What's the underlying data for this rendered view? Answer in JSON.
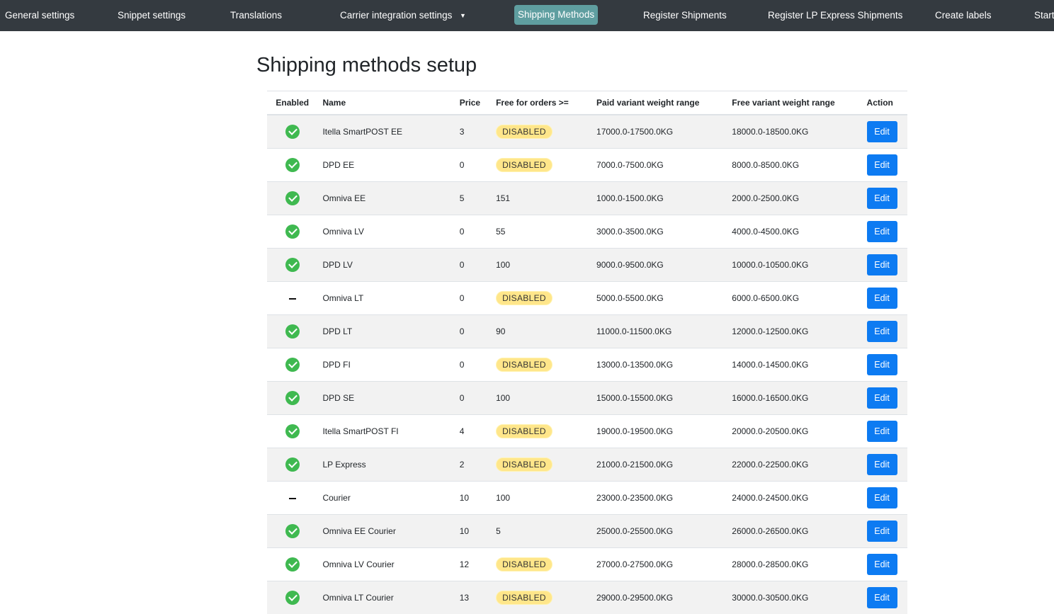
{
  "nav": {
    "items": [
      {
        "label": "General settings",
        "active": false
      },
      {
        "label": "Snippet settings",
        "active": false
      },
      {
        "label": "Translations",
        "active": false
      },
      {
        "label": "Carrier integration settings",
        "active": false,
        "dropdown": true
      },
      {
        "label": "Shipping Methods",
        "active": true
      },
      {
        "label": "Register Shipments",
        "active": false
      },
      {
        "label": "Register LP Express Shipments",
        "active": false
      },
      {
        "label": "Create labels",
        "active": false
      },
      {
        "label": "Starti",
        "active": false
      }
    ],
    "dropdown_icon": "caret-down-icon",
    "active_color": "#5f9ea0",
    "bar_color": "#343a40"
  },
  "page": {
    "title": "Shipping methods setup"
  },
  "table": {
    "headers": {
      "enabled": "Enabled",
      "name": "Name",
      "price": "Price",
      "free": "Free for orders >=",
      "paid_range": "Paid variant weight range",
      "free_range": "Free variant weight range",
      "action": "Action"
    },
    "edit_label": "Edit",
    "disabled_label": "DISABLED",
    "rows": [
      {
        "enabled": true,
        "name": "Itella SmartPOST EE",
        "price": "3",
        "free": null,
        "paid_range": "17000.0-17500.0KG",
        "free_range": "18000.0-18500.0KG"
      },
      {
        "enabled": true,
        "name": "DPD EE",
        "price": "0",
        "free": null,
        "paid_range": "7000.0-7500.0KG",
        "free_range": "8000.0-8500.0KG"
      },
      {
        "enabled": true,
        "name": "Omniva EE",
        "price": "5",
        "free": "151",
        "paid_range": "1000.0-1500.0KG",
        "free_range": "2000.0-2500.0KG"
      },
      {
        "enabled": true,
        "name": "Omniva LV",
        "price": "0",
        "free": "55",
        "paid_range": "3000.0-3500.0KG",
        "free_range": "4000.0-4500.0KG"
      },
      {
        "enabled": true,
        "name": "DPD LV",
        "price": "0",
        "free": "100",
        "paid_range": "9000.0-9500.0KG",
        "free_range": "10000.0-10500.0KG"
      },
      {
        "enabled": false,
        "name": "Omniva LT",
        "price": "0",
        "free": null,
        "paid_range": "5000.0-5500.0KG",
        "free_range": "6000.0-6500.0KG"
      },
      {
        "enabled": true,
        "name": "DPD LT",
        "price": "0",
        "free": "90",
        "paid_range": "11000.0-11500.0KG",
        "free_range": "12000.0-12500.0KG"
      },
      {
        "enabled": true,
        "name": "DPD FI",
        "price": "0",
        "free": null,
        "paid_range": "13000.0-13500.0KG",
        "free_range": "14000.0-14500.0KG"
      },
      {
        "enabled": true,
        "name": "DPD SE",
        "price": "0",
        "free": "100",
        "paid_range": "15000.0-15500.0KG",
        "free_range": "16000.0-16500.0KG"
      },
      {
        "enabled": true,
        "name": "Itella SmartPOST FI",
        "price": "4",
        "free": null,
        "paid_range": "19000.0-19500.0KG",
        "free_range": "20000.0-20500.0KG"
      },
      {
        "enabled": true,
        "name": "LP Express",
        "price": "2",
        "free": null,
        "paid_range": "21000.0-21500.0KG",
        "free_range": "22000.0-22500.0KG"
      },
      {
        "enabled": false,
        "name": "Courier",
        "price": "10",
        "free": "100",
        "paid_range": "23000.0-23500.0KG",
        "free_range": "24000.0-24500.0KG"
      },
      {
        "enabled": true,
        "name": "Omniva EE Courier",
        "price": "10",
        "free": "5",
        "paid_range": "25000.0-25500.0KG",
        "free_range": "26000.0-26500.0KG"
      },
      {
        "enabled": true,
        "name": "Omniva LV Courier",
        "price": "12",
        "free": null,
        "paid_range": "27000.0-27500.0KG",
        "free_range": "28000.0-28500.0KG"
      },
      {
        "enabled": true,
        "name": "Omniva LT Courier",
        "price": "13",
        "free": null,
        "paid_range": "29000.0-29500.0KG",
        "free_range": "30000.0-30500.0KG"
      }
    ],
    "icons": {
      "enabled": "check-circle-icon",
      "not_enabled": "dash-icon"
    },
    "colors": {
      "check": "#3fb950",
      "edit_button": "#0d7bf2",
      "disabled_badge": "#ffe68a",
      "stripe": "#f2f2f2"
    }
  }
}
